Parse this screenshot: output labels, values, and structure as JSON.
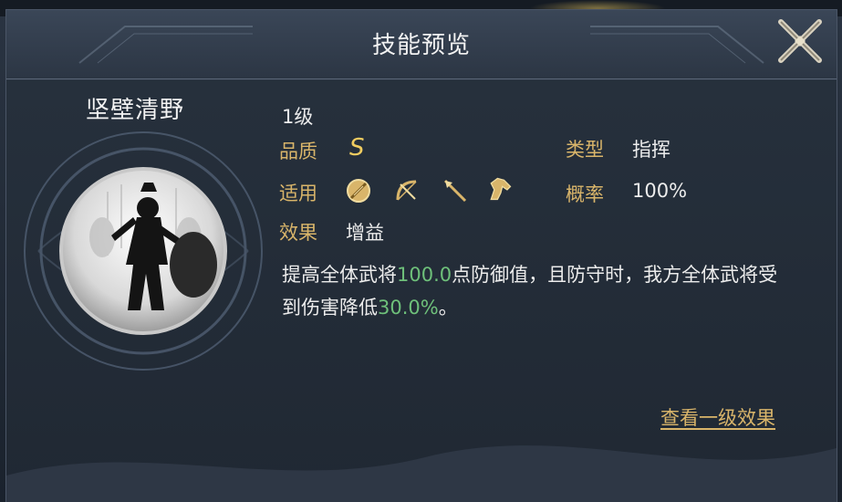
{
  "header": {
    "title": "技能预览"
  },
  "skill": {
    "name": "坚壁清野",
    "level": "1级",
    "quality_label": "品质",
    "quality_value": "S",
    "type_label": "类型",
    "type_value": "指挥",
    "applies_label": "适用",
    "applies_icons": [
      "shield-troop-icon",
      "bow-troop-icon",
      "spear-troop-icon",
      "cavalry-troop-icon"
    ],
    "chance_label": "概率",
    "chance_value": "100%",
    "effect_label": "效果",
    "effect_value": "增益",
    "description": {
      "part1": "提高全体武将",
      "value1": "100.0",
      "part2": "点防御值，且防守时，我方全体武将受到伤害降低",
      "value2": "30.0%",
      "part3": "。"
    }
  },
  "footer": {
    "view_level_effect": "查看一级效果"
  },
  "colors": {
    "label_gold": "#d9b56a",
    "highlight_green": "#6ec07a",
    "grade_gold": "#f0cc60"
  }
}
